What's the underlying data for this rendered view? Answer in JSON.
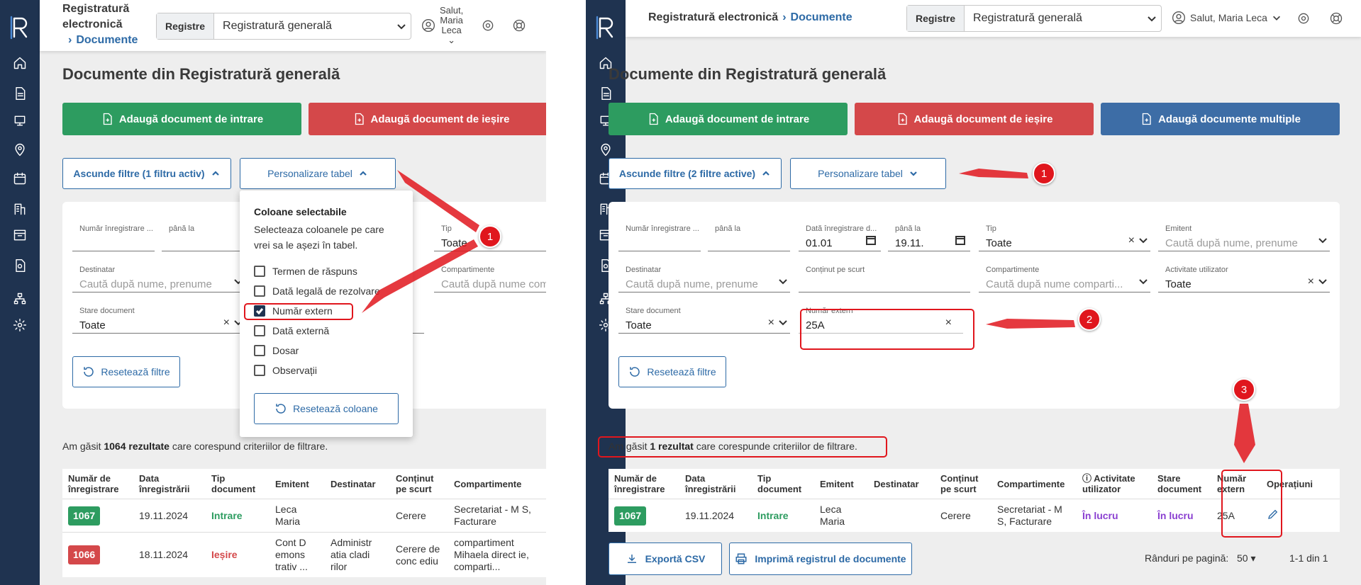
{
  "app": {
    "title": "Registratură electronică",
    "title_line1": "Registratură",
    "title_line2": "electronică",
    "breadcrumb": "Documente"
  },
  "registry": {
    "label": "Registre",
    "value": "Registratură generală"
  },
  "user": {
    "greeting": "Salut, Maria Leca",
    "line1": "Salut,",
    "line2": "Maria",
    "line3": "Leca"
  },
  "page_title": "Documente din Registratură generală",
  "buttons": {
    "add_in": "Adaugă document de intrare",
    "add_out": "Adaugă document de ieșire",
    "add_multi": "Adaugă documente multiple",
    "export_csv": "Exportă CSV",
    "print": "Imprimă registrul de documente",
    "reset_filters": "Resetează filtre",
    "reset_columns": "Resetează coloane",
    "customize": "Personalizare tabel"
  },
  "left": {
    "hide_filters": "Ascunde filtre (1 filtru activ)",
    "filters": {
      "nr_from": "Număr înregistrare ...",
      "nr_to": "până la",
      "tip_label": "Tip",
      "tip_value": "Toate",
      "destinatar_label": "Destinatar",
      "destinatar_ph": "Caută după nume, prenume",
      "compartimente_label": "Compartimente",
      "compartimente_ph": "Caută după nume comp",
      "stare_label": "Stare document",
      "stare_value": "Toate"
    },
    "dropdown": {
      "title": "Coloane selectabile",
      "desc1": "Selecteaza coloanele pe care",
      "desc2": "vrei sa le așezi în tabel.",
      "options": [
        "Termen de răspuns",
        "Dată legală de rezolvare",
        "Număr extern",
        "Dată externă",
        "Dosar",
        "Observații"
      ],
      "checked": "Număr extern"
    },
    "found_pre": "Am găsit ",
    "found_bold": "1064 rezultate",
    "found_post": " care corespund criteriilor de filtrare.",
    "columns": [
      "Număr de înregistrare",
      "Data înregistrării",
      "Tip document",
      "Emitent",
      "Destinatar",
      "Conținut pe scurt",
      "Compartimente"
    ],
    "rows": [
      {
        "nr": "1067",
        "data": "19.11.2024",
        "tip": "Intrare",
        "emitent": "Leca Maria",
        "destinatar": "",
        "continut": "Cerere",
        "compartimente": "Secretariat - M S, Facturare"
      },
      {
        "nr": "1066",
        "data": "18.11.2024",
        "tip": "Ieșire",
        "emitent": "Cont D emons trativ ...",
        "destinatar": "Administr atia cladi rilor",
        "continut": "Cerere de conc ediu",
        "compartimente": "compartiment Mihaela direct ie, comparti..."
      }
    ]
  },
  "right": {
    "hide_filters": "Ascunde filtre (2 filtre active)",
    "filters": {
      "nr_from": "Număr înregistrare ...",
      "nr_to": "până la",
      "data_from_label": "Dată înregistrare d...",
      "data_from": "01.01",
      "data_to_label": "până la",
      "data_to": "19.11.",
      "tip_label": "Tip",
      "tip_value": "Toate",
      "emitent_label": "Emitent",
      "emitent_ph": "Caută după nume, prenume",
      "destinatar_label": "Destinatar",
      "destinatar_ph": "Caută după nume, prenume",
      "continut_label": "Conținut pe scurt",
      "compartimente_label": "Compartimente",
      "compartimente_ph": "Caută după nume comparti...",
      "activitate_label": "Activitate utilizator",
      "activitate_value": "Toate",
      "stare_label": "Stare document",
      "stare_value": "Toate",
      "nrext_label": "Număr extern",
      "nrext_value": "25A"
    },
    "found_pre": "Am găsit ",
    "found_bold": "1 rezultat",
    "found_post": " care corespunde criteriilor de filtrare.",
    "columns": [
      "Număr de înregistrare",
      "Data înregistrării",
      "Tip document",
      "Emitent",
      "Destinatar",
      "Conținut pe scurt",
      "Compartimente",
      "Activitate utilizator",
      "Stare document",
      "Număr extern",
      "Operațiuni"
    ],
    "row": {
      "nr": "1067",
      "data": "19.11.2024",
      "tip": "Intrare",
      "emitent": "Leca Maria",
      "destinatar": "",
      "continut": "Cerere",
      "compartimente": "Secretariat - M S, Facturare",
      "activitate": "În lucru",
      "stare": "În lucru",
      "nrext": "25A"
    },
    "rows_per_page_label": "Rânduri pe pagină:",
    "rows_per_page": "50",
    "page_range": "1-1 din 1"
  },
  "annotations": {
    "one": "1",
    "two": "2",
    "three": "3"
  },
  "colors": {
    "sidebar": "#1f3350",
    "green": "#2d9c60",
    "red": "#d4484a",
    "blue": "#3d6da6",
    "link": "#2d6aa6",
    "annotation": "#e0161d",
    "purple": "#8a3fd1"
  }
}
